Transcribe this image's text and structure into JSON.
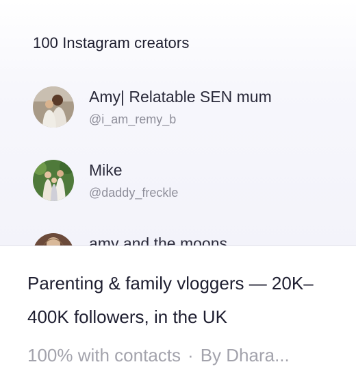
{
  "preview": {
    "title": "100 Instagram creators",
    "creators": [
      {
        "name": "Amy| Relatable SEN mum",
        "handle": "@i_am_remy_b",
        "avatar_icon": "avatar-photo-icon"
      },
      {
        "name": "Mike",
        "handle": "@daddy_freckle",
        "avatar_icon": "avatar-photo-icon"
      },
      {
        "name": "amy and the moons",
        "handle": "",
        "avatar_icon": "avatar-photo-icon"
      }
    ]
  },
  "list": {
    "title": "Parenting & family vloggers — 20K–400K followers, in the UK",
    "contacts_text": "100% with contacts",
    "separator": "·",
    "author_text": "By Dhara..."
  },
  "colors": {
    "title_text": "#1e1e30",
    "muted_text": "#a3a3ac",
    "handle_text": "#8e8e9a",
    "preview_bg": "#f3f3fa"
  }
}
